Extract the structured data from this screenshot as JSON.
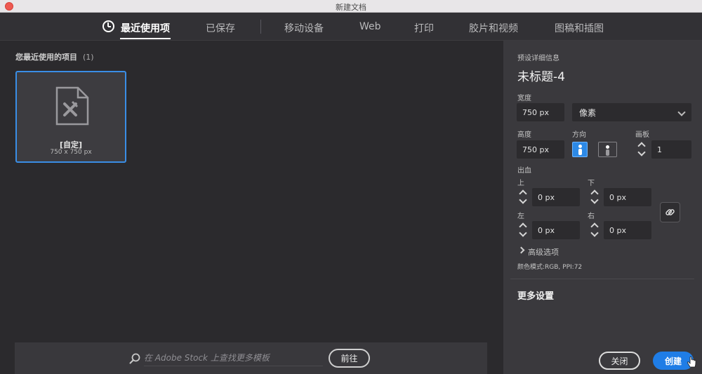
{
  "window": {
    "title": "新建文档"
  },
  "tabs": [
    {
      "label": "最近使用项",
      "active": true
    },
    {
      "label": "已保存"
    },
    {
      "label": "移动设备"
    },
    {
      "label": "Web"
    },
    {
      "label": "打印"
    },
    {
      "label": "胶片和视频"
    },
    {
      "label": "图稿和插图"
    }
  ],
  "recent": {
    "header": "您最近使用的项目",
    "count": "(1)",
    "items": [
      {
        "name": "[自定]",
        "size": "750 x 750 px"
      }
    ]
  },
  "stock": {
    "placeholder": "在 Adobe Stock 上查找更多模板",
    "go_label": "前往"
  },
  "details": {
    "section_label": "预设详细信息",
    "doc_name": "未标题-4",
    "width_label": "宽度",
    "width_value": "750 px",
    "unit_value": "像素",
    "height_label": "高度",
    "height_value": "750 px",
    "orientation_label": "方向",
    "artboards_label": "画板",
    "artboards_value": "1",
    "bleed_label": "出血",
    "bleed": {
      "top_label": "上",
      "top_value": "0 px",
      "bottom_label": "下",
      "bottom_value": "0 px",
      "left_label": "左",
      "left_value": "0 px",
      "right_label": "右",
      "right_value": "0 px"
    },
    "advanced_label": "高级选项",
    "color_mode": "颜色模式:RGB, PPI:72",
    "more_settings_label": "更多设置"
  },
  "actions": {
    "close_label": "关闭",
    "create_label": "创建"
  },
  "colors": {
    "accent": "#1f7de6",
    "selection_border": "#3a8ee6",
    "panel_bg": "#3a393d",
    "main_bg": "#2b2a2d"
  },
  "icons": [
    "clock-icon",
    "document-preset-icon",
    "search-icon",
    "portrait-icon",
    "landscape-icon",
    "link-icon",
    "chevron-right-icon",
    "chevron-down-icon",
    "stepper-icon",
    "cursor-icon"
  ]
}
